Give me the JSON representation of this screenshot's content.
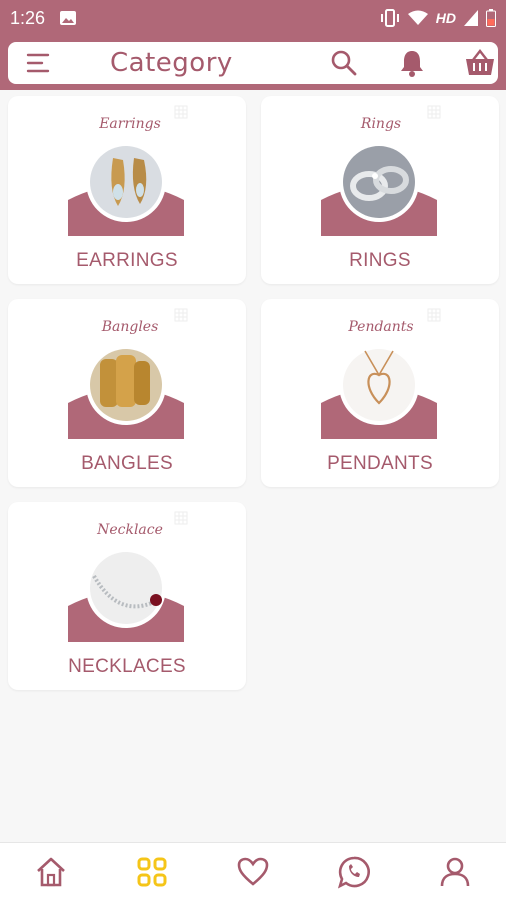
{
  "status": {
    "time": "1:26",
    "network": "HD"
  },
  "header": {
    "title": "Category",
    "menu_icon": "hamburger-menu-icon",
    "search_icon": "search-icon",
    "bell_icon": "bell-icon",
    "cart_icon": "shopping-basket-icon"
  },
  "categories": [
    {
      "label": "EARRINGS",
      "script_title": "Earrings"
    },
    {
      "label": "RINGS",
      "script_title": "Rings"
    },
    {
      "label": "BANGLES",
      "script_title": "Bangles"
    },
    {
      "label": "PENDANTS",
      "script_title": "Pendants"
    },
    {
      "label": "NECKLACES",
      "script_title": "Necklace"
    }
  ],
  "bottom_nav": [
    {
      "icon": "home-icon"
    },
    {
      "icon": "grid-icon",
      "active": true
    },
    {
      "icon": "heart-icon"
    },
    {
      "icon": "whatsapp-icon"
    },
    {
      "icon": "user-icon"
    }
  ],
  "colors": {
    "accent": "#b06878",
    "text": "#a55a6c",
    "active": "#f5c518"
  }
}
